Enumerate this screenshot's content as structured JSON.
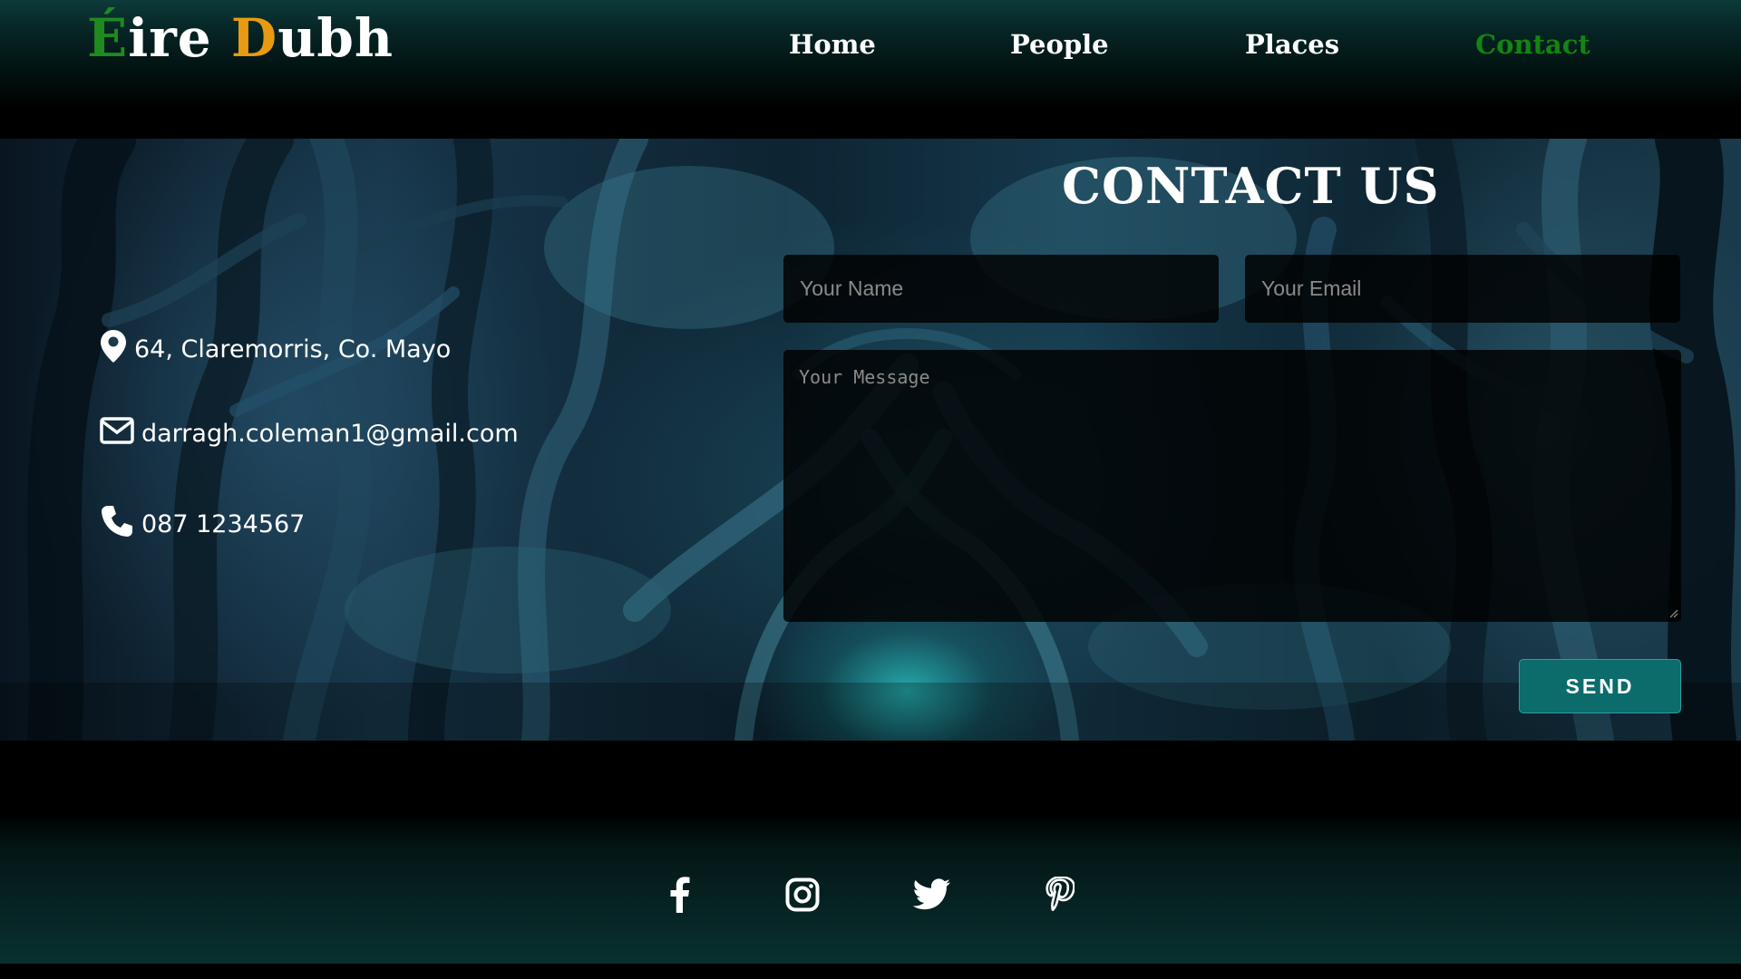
{
  "header": {
    "logo_parts": [
      "É",
      "ire ",
      "D",
      "ubh"
    ],
    "nav": [
      {
        "label": "Home",
        "active": false
      },
      {
        "label": "People",
        "active": false
      },
      {
        "label": "Places",
        "active": false
      },
      {
        "label": "Contact",
        "active": true
      }
    ]
  },
  "contact_info": {
    "address": "64, Claremorris, Co. Mayo",
    "email": "darragh.coleman1@gmail.com",
    "phone": "087 1234567",
    "icons": [
      "map-marker-icon",
      "envelope-icon",
      "phone-icon"
    ]
  },
  "form": {
    "title": "CONTACT US",
    "name_placeholder": "Your Name",
    "email_placeholder": "Your Email",
    "message_placeholder": "Your Message",
    "send_label": "SEND"
  },
  "footer": {
    "social_icons": [
      "facebook-icon",
      "instagram-icon",
      "twitter-icon",
      "pinterest-icon"
    ]
  },
  "colors": {
    "logo_green": "#1f8a1f",
    "logo_orange": "#e89a12",
    "nav_active": "#128512",
    "send_button": "#0c6b6b",
    "footer_teal": "#093030"
  }
}
